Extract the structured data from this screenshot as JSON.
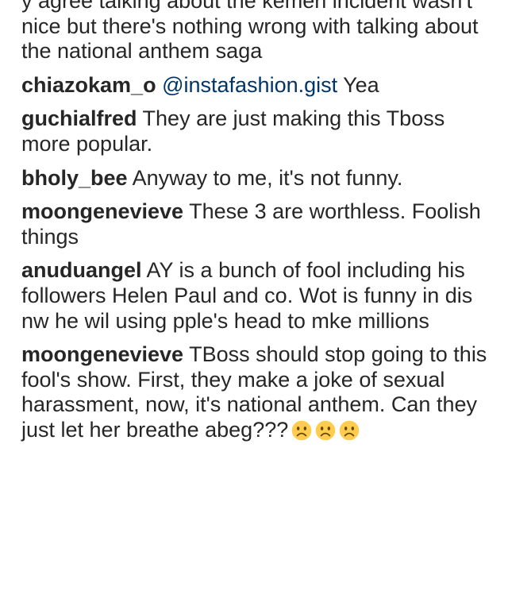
{
  "comments": [
    {
      "username": "",
      "text": "y agree talking about the kemen incident wasn't nice but there's nothing wrong with talking about the national anthem saga"
    },
    {
      "username": "chiazokam_o",
      "mention": "@instafashion.gist",
      "text": "Yea"
    },
    {
      "username": "guchialfred",
      "text": "They are just making this Tboss more popular."
    },
    {
      "username": "bholy_bee",
      "text": "Anyway to me, it's not funny."
    },
    {
      "username": "moongenevieve",
      "text": "These 3 are worthless. Foolish things"
    },
    {
      "username": "anuduangel",
      "text": "AY is a bunch of fool including his followers Helen Paul and co. Wot is funny in dis nw he wil using pple's head to mke millions"
    },
    {
      "username": "moongenevieve",
      "text": "TBoss should stop going to this fool's show. First, they make a joke of sexual harassment, now, it's national anthem. Can they just let her breathe abeg???",
      "emojis": [
        "frowning-face-icon",
        "frowning-face-icon",
        "frowning-face-icon"
      ]
    }
  ],
  "colors": {
    "text": "#262626",
    "mention": "#003569",
    "emoji_face": "#FFCC4D",
    "emoji_features": "#664500"
  }
}
